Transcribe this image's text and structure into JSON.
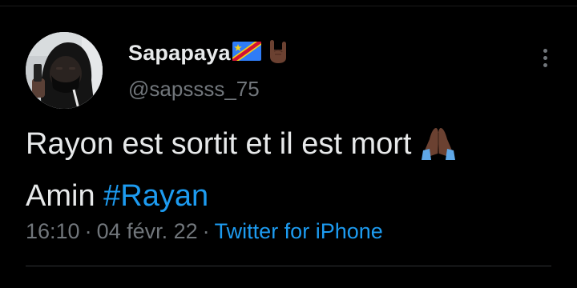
{
  "tweet": {
    "author": {
      "display_name": "Sapapaya",
      "handle": "@sapssss_75",
      "name_emojis": [
        "flag-dr-congo-icon",
        "sign-of-horns-icon"
      ]
    },
    "text_line1": "Rayon est sortit et il est mort",
    "text_line2_prefix": "Amin",
    "hashtag": "#Rayan",
    "text_emoji": "folded-hands-icon",
    "time": "16:10",
    "date": "04 févr. 22",
    "separator": "·",
    "source": "Twitter for iPhone"
  },
  "colors": {
    "background": "#000000",
    "primary_text": "#e7e9ea",
    "secondary_text": "#71767b",
    "link": "#1d9bf0",
    "divider": "#2f3336"
  }
}
